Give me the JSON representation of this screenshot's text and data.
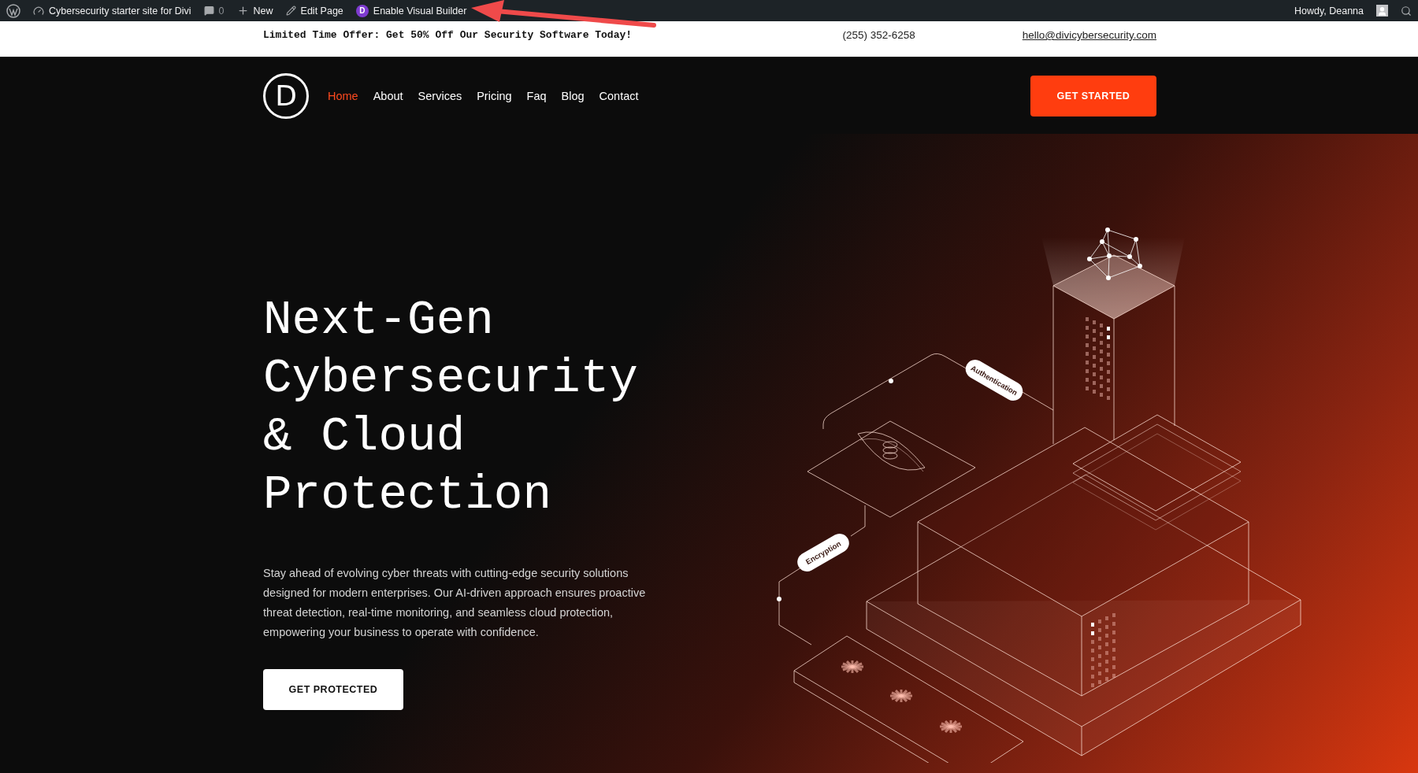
{
  "admin_bar": {
    "items": [
      {
        "kind": "site",
        "label": "Cybersecurity starter site for Divi"
      },
      {
        "kind": "comments",
        "label": "0"
      },
      {
        "kind": "new",
        "label": "New"
      },
      {
        "kind": "edit",
        "label": "Edit Page"
      },
      {
        "kind": "builder",
        "label": "Enable Visual Builder",
        "badge": "D"
      }
    ],
    "greeting": "Howdy, Deanna"
  },
  "top_bar": {
    "offer": "Limited Time Offer: Get 50% Off Our Security Software Today!",
    "phone": "(255) 352-6258",
    "email": "hello@divicybersecurity.com"
  },
  "nav": {
    "logo_letter": "D",
    "links": [
      {
        "label": "Home",
        "selected": true
      },
      {
        "label": "About",
        "selected": false
      },
      {
        "label": "Services",
        "selected": false
      },
      {
        "label": "Pricing",
        "selected": false
      },
      {
        "label": "Faq",
        "selected": false
      },
      {
        "label": "Blog",
        "selected": false
      },
      {
        "label": "Contact",
        "selected": false
      }
    ],
    "cta": "GET STARTED"
  },
  "hero": {
    "heading_lines": [
      "Next-Gen",
      "Cybersecurity",
      "& Cloud",
      "Protection"
    ],
    "paragraph": "Stay ahead of evolving cyber threats with cutting-edge security solutions designed for modern enterprises. Our AI-driven approach ensures proactive threat detection, real-time monitoring, and seamless cloud protection, empowering your business to operate with confidence.",
    "button": "GET PROTECTED",
    "diagram_labels": [
      "Authentication",
      "Encryption"
    ]
  }
}
